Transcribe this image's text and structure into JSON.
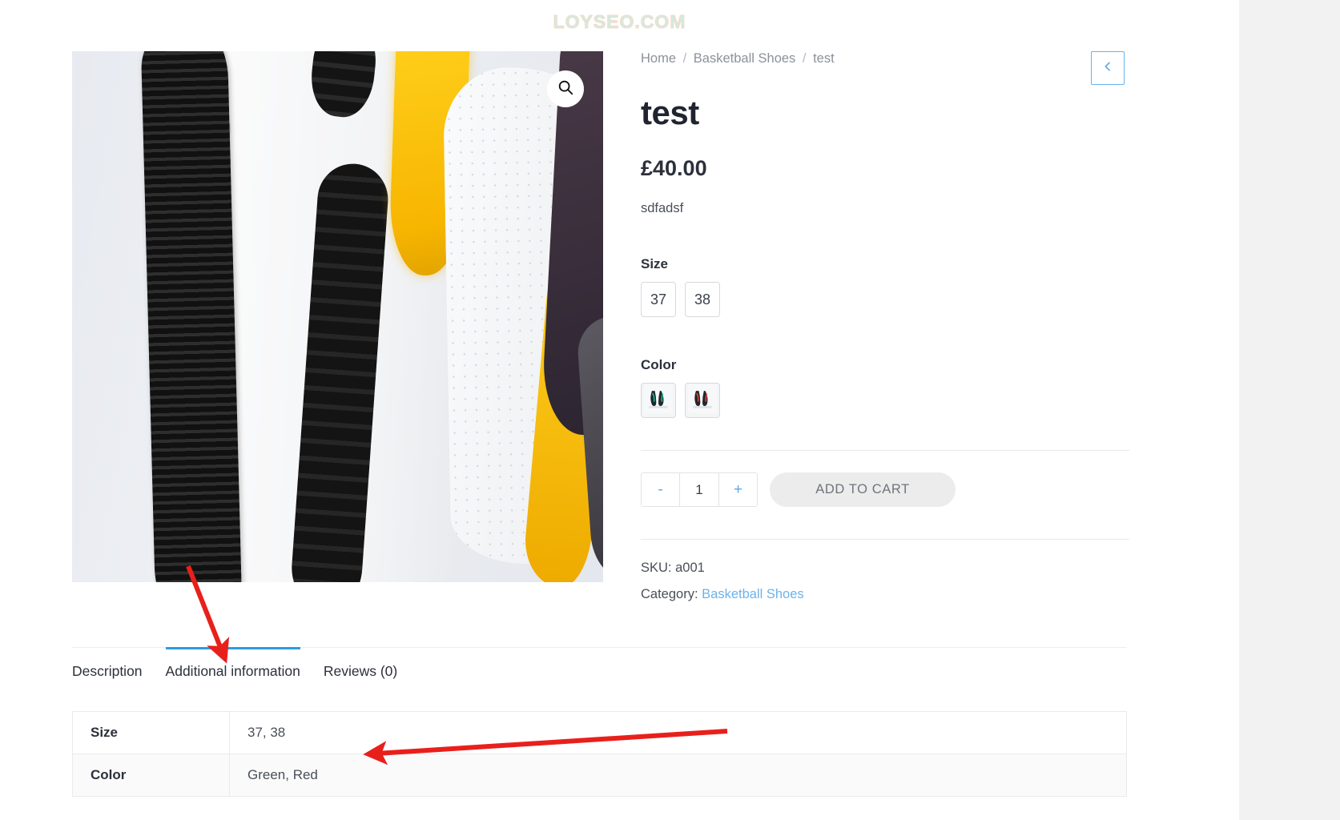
{
  "watermark": "LOYSEO.COM",
  "breadcrumb": {
    "home": "Home",
    "category": "Basketball Shoes",
    "current": "test",
    "separator": "/"
  },
  "product": {
    "title": "test",
    "price": "£40.00",
    "short_description": "sdfadsf",
    "sku_label": "SKU:",
    "sku": "a001",
    "category_label": "Category:",
    "category": "Basketball Shoes"
  },
  "attributes": [
    {
      "label": "Size",
      "options": [
        "37",
        "38"
      ],
      "type": "text"
    },
    {
      "label": "Color",
      "options": [
        "Green",
        "Red"
      ],
      "type": "image"
    }
  ],
  "cart": {
    "decrease": "-",
    "quantity": "1",
    "increase": "+",
    "add_to_cart": "ADD TO CART"
  },
  "gallery": {
    "zoom_icon": "search-icon",
    "alt": "Air Max sneaker sole close-up"
  },
  "nav": {
    "previous_icon": "chevron-left-icon"
  },
  "tabs": [
    {
      "label": "Description",
      "active": false
    },
    {
      "label": "Additional information",
      "active": true
    },
    {
      "label": "Reviews (0)",
      "active": false
    }
  ],
  "additional_information": {
    "rows": [
      {
        "name": "Size",
        "value": "37, 38"
      },
      {
        "name": "Color",
        "value": "Green, Red"
      }
    ]
  },
  "colors": {
    "accent_blue": "#2e9bdf",
    "link_blue": "#6cb2eb",
    "annotation_red": "#e8201c",
    "watermark": "#cdece2",
    "text_dark": "#2b303a",
    "muted": "#8c919b"
  }
}
